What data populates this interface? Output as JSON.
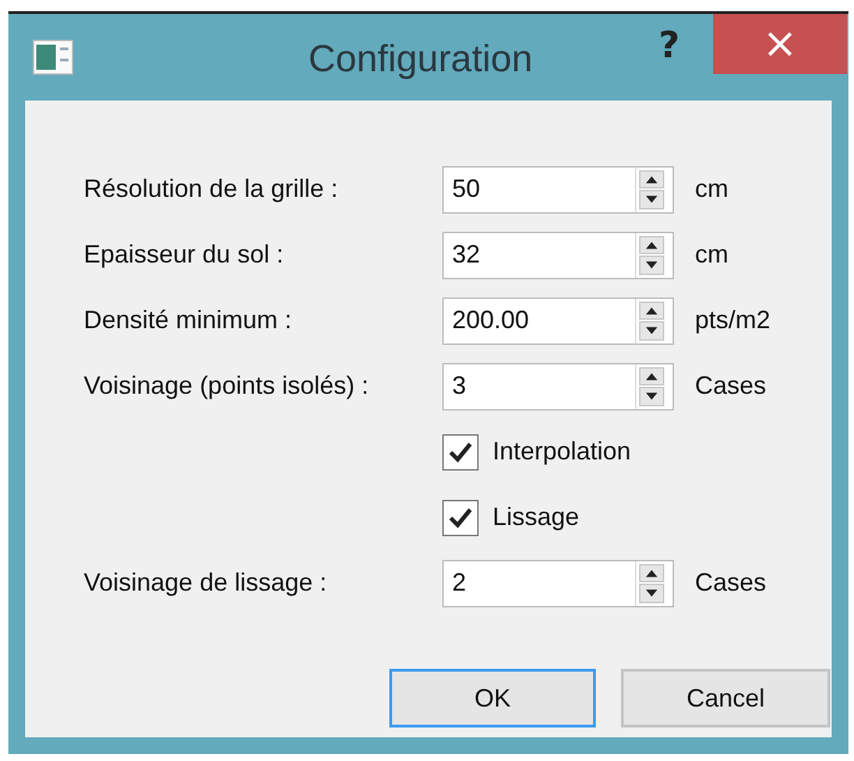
{
  "window": {
    "title": "Configuration",
    "help": "?",
    "close": "×"
  },
  "rows": [
    {
      "kind": "spin",
      "label": "Résolution de la grille :",
      "value": "50",
      "unit": "cm"
    },
    {
      "kind": "spin",
      "label": "Epaisseur du sol :",
      "value": "32",
      "unit": "cm"
    },
    {
      "kind": "spin",
      "label": "Densité minimum :",
      "value": "200.00",
      "unit": "pts/m2"
    },
    {
      "kind": "spin",
      "label": "Voisinage (points isolés) :",
      "value": "3",
      "unit": "Cases"
    },
    {
      "kind": "checkbox",
      "label": "Interpolation",
      "checked": true
    },
    {
      "kind": "checkbox",
      "label": "Lissage",
      "checked": true
    },
    {
      "kind": "spin",
      "label": "Voisinage de lissage :",
      "value": "2",
      "unit": "Cases"
    }
  ],
  "buttons": [
    {
      "label": "OK",
      "default": true
    },
    {
      "label": "Cancel",
      "default": false
    }
  ]
}
